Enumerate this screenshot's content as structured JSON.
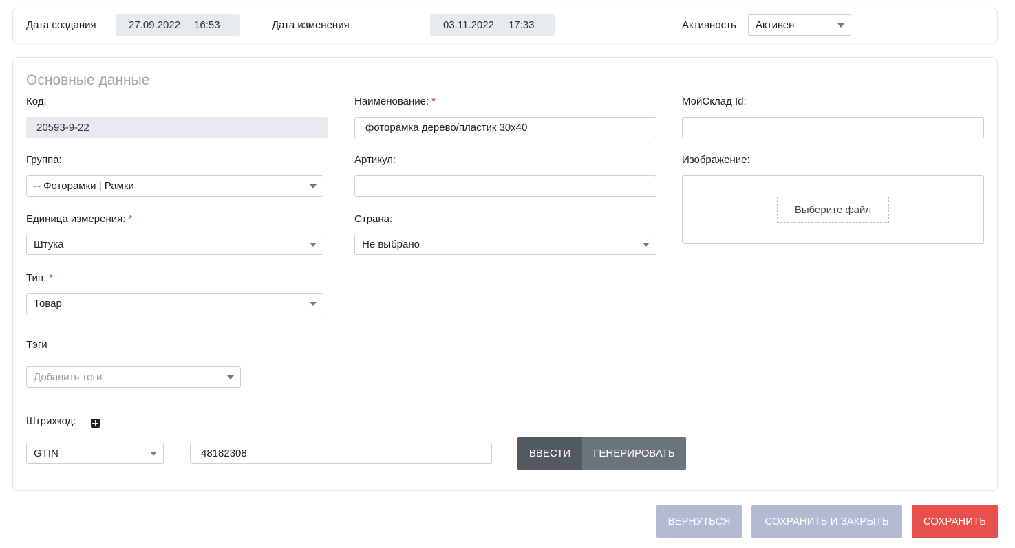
{
  "header": {
    "created_label": "Дата создания",
    "created_date": "27.09.2022",
    "created_time": "16:53",
    "modified_label": "Дата изменения",
    "modified_date": "03.11.2022",
    "modified_time": "17:33",
    "activity_label": "Активность",
    "activity_value": "Активен"
  },
  "main": {
    "section_title": "Основные данные",
    "code_label": "Код:",
    "code_value": "20593-9-22",
    "name_label": "Наименование:",
    "name_value": "фоторамка дерево/пластик 30х40",
    "moysklad_label": "МойСклад Id:",
    "moysklad_value": "",
    "group_label": "Группа:",
    "group_value": "-- Фоторамки | Рамки",
    "article_label": "Артикул:",
    "article_value": "",
    "image_label": "Изображение:",
    "choose_file": "Выберите файл",
    "unit_label": "Единица измерения:",
    "unit_value": "Штука",
    "country_label": "Страна:",
    "country_value": "Не выбрано",
    "type_label": "Тип:",
    "type_value": "Товар",
    "tags_label": "Тэги",
    "tags_placeholder": "Добавить теги",
    "barcode_label": "Штрихкод:",
    "barcode_type": "GTIN",
    "barcode_value": "48182308",
    "enter_button": "ВВЕСТИ",
    "generate_button": "ГЕНЕРИРОВАТЬ",
    "required_mark": "*"
  },
  "footer": {
    "back_button": "ВЕРНУТЬСЯ",
    "save_close_button": "СОХРАНИТЬ И ЗАКРЫТЬ",
    "save_button": "СОХРАНИТЬ"
  },
  "colors": {
    "primary_red": "#e8504b",
    "muted_button": "#b3bad1",
    "dark_button": "#525961",
    "gray_button": "#6b737c",
    "required": "#d32f2f"
  }
}
